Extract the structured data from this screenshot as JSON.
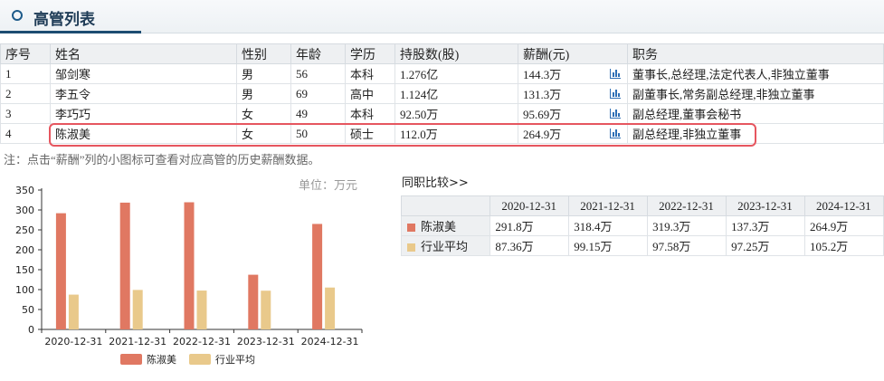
{
  "header": {
    "title": "高管列表"
  },
  "table": {
    "columns": [
      "序号",
      "姓名",
      "性别",
      "年龄",
      "学历",
      "持股数(股)",
      "薪酬(元)",
      "职务"
    ],
    "rows": [
      {
        "no": "1",
        "name": "邹剑寒",
        "gender": "男",
        "age": "56",
        "edu": "本科",
        "shares": "1.276亿",
        "salary": "144.3万",
        "position": "董事长,总经理,法定代表人,非独立董事"
      },
      {
        "no": "2",
        "name": "李五令",
        "gender": "男",
        "age": "69",
        "edu": "高中",
        "shares": "1.124亿",
        "salary": "131.3万",
        "position": "副董事长,常务副总经理,非独立董事"
      },
      {
        "no": "3",
        "name": "李巧巧",
        "gender": "女",
        "age": "49",
        "edu": "本科",
        "shares": "92.50万",
        "salary": "95.69万",
        "position": "副总经理,董事会秘书"
      },
      {
        "no": "4",
        "name": "陈淑美",
        "gender": "女",
        "age": "50",
        "edu": "硕士",
        "shares": "112.0万",
        "salary": "264.9万",
        "position": "副总经理,非独立董事"
      }
    ],
    "selected_row": 3
  },
  "note": "注：点击“薪酬”列的小图标可查看对应高管的历史薪酬数据。",
  "chart_unit": "单位：万元",
  "chart_data": {
    "type": "bar",
    "categories": [
      "2020-12-31",
      "2021-12-31",
      "2022-12-31",
      "2023-12-31",
      "2024-12-31"
    ],
    "series": [
      {
        "name": "陈淑美",
        "values": [
          291.8,
          318.4,
          319.3,
          137.3,
          264.9
        ],
        "color": "#e07862"
      },
      {
        "name": "行业平均",
        "values": [
          87.36,
          99.15,
          97.58,
          97.25,
          105.2
        ],
        "color": "#e9c98b"
      }
    ],
    "ylim": [
      0,
      350
    ],
    "yticks": [
      0,
      50,
      100,
      150,
      200,
      250,
      300,
      350
    ]
  },
  "comparison": {
    "title": "同职比较>>",
    "dates": [
      "2020-12-31",
      "2021-12-31",
      "2022-12-31",
      "2023-12-31",
      "2024-12-31"
    ],
    "rows": [
      {
        "label": "陈淑美",
        "color": "#e07862",
        "values": [
          "291.8万",
          "318.4万",
          "319.3万",
          "137.3万",
          "264.9万"
        ]
      },
      {
        "label": "行业平均",
        "color": "#e9c98b",
        "values": [
          "87.36万",
          "99.15万",
          "97.58万",
          "97.25万",
          "105.2万"
        ]
      }
    ]
  }
}
